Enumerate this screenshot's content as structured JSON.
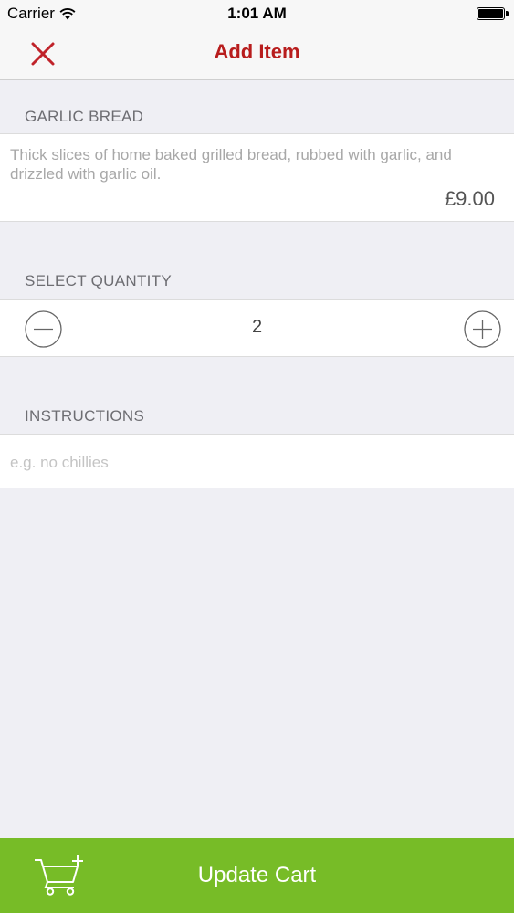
{
  "status_bar": {
    "carrier": "Carrier",
    "time": "1:01 AM",
    "wifi_icon": "wifi-icon",
    "battery_icon": "battery-icon"
  },
  "nav": {
    "title": "Add Item",
    "close_icon": "close-icon",
    "title_color": "#b81d1d"
  },
  "item": {
    "name": "GARLIC BREAD",
    "description": "Thick slices of home baked grilled bread, rubbed with garlic, and drizzled with garlic oil.",
    "price": "£9.00"
  },
  "quantity": {
    "header": "SELECT QUANTITY",
    "value": "2",
    "decrement_icon": "minus-circle-icon",
    "increment_icon": "plus-circle-icon"
  },
  "instructions": {
    "header": "INSTRUCTIONS",
    "placeholder": "e.g. no chillies",
    "value": ""
  },
  "footer": {
    "button_label": "Update Cart",
    "cart_icon": "cart-plus-icon",
    "accent_color": "#77bc27"
  }
}
